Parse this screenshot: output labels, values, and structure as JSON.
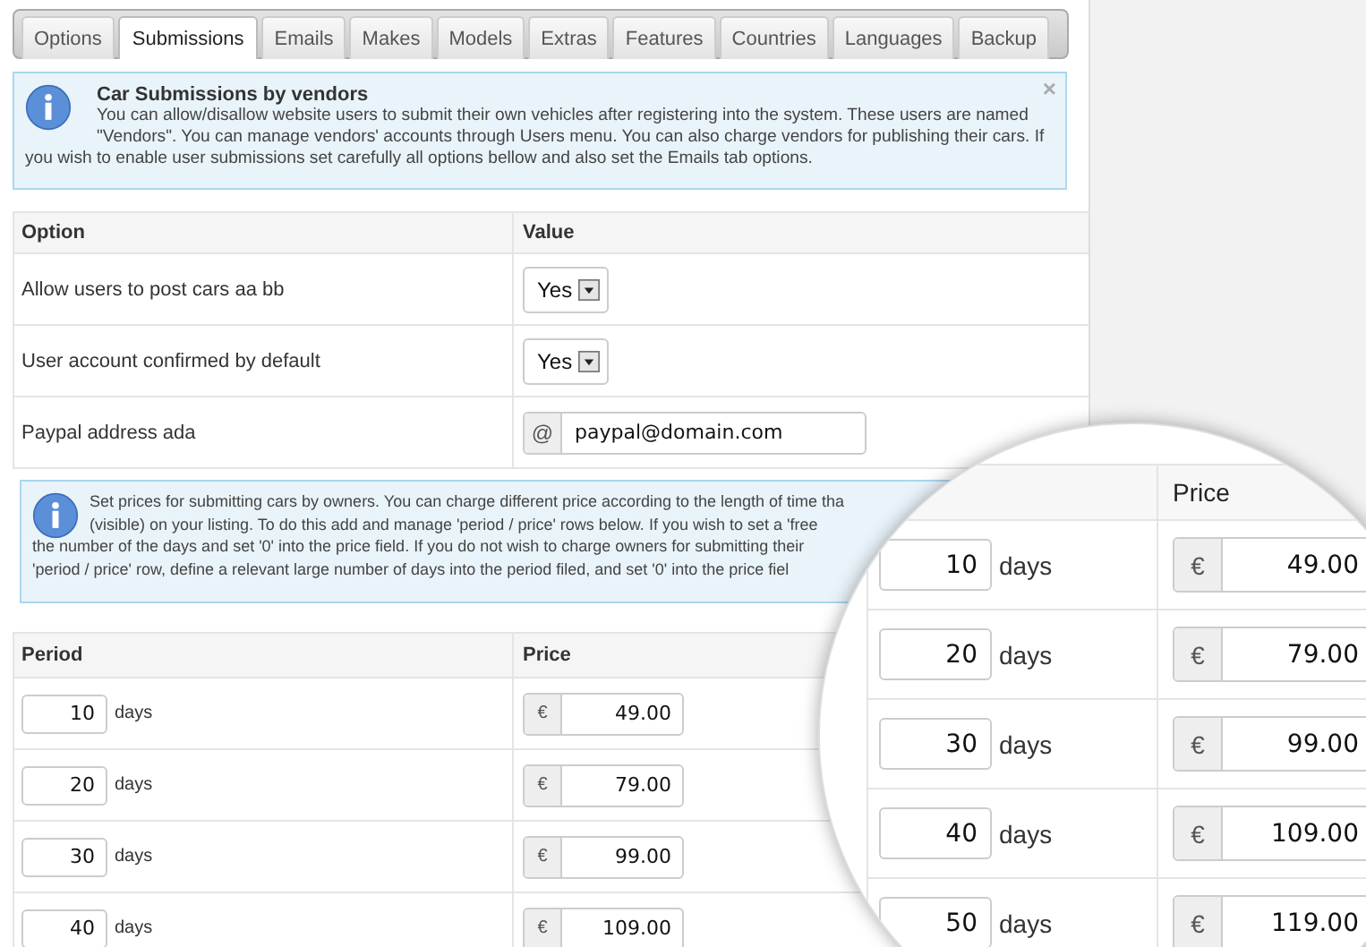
{
  "tabs": [
    {
      "label": "Options",
      "selected": false
    },
    {
      "label": "Submissions",
      "selected": true
    },
    {
      "label": "Emails",
      "selected": false
    },
    {
      "label": "Makes",
      "selected": false
    },
    {
      "label": "Models",
      "selected": false
    },
    {
      "label": "Extras",
      "selected": false
    },
    {
      "label": "Features",
      "selected": false
    },
    {
      "label": "Countries",
      "selected": false
    },
    {
      "label": "Languages",
      "selected": false
    },
    {
      "label": "Backup",
      "selected": false
    }
  ],
  "notice": {
    "title": "Car Submissions by vendors",
    "lines": [
      "You can allow/disallow website users to submit their own vehicles after registering into the system. These users are named",
      "\"Vendors\". You can manage vendors' accounts through Users menu. You can also charge vendors for publishing their cars. If",
      "you wish to enable user submissions set carefully all options bellow and also set the Emails tab options."
    ],
    "close": "×"
  },
  "options_table": {
    "columns": [
      "Option",
      "Value"
    ],
    "rows": [
      {
        "kind": "select",
        "label": "Allow users to post cars aa bb",
        "value": "Yes"
      },
      {
        "kind": "select",
        "label": "User account confirmed by default",
        "value": "Yes"
      },
      {
        "kind": "email",
        "label": "Paypal address ada",
        "prefix": "@",
        "value": "paypal@domain.com"
      }
    ]
  },
  "pricing_notice": {
    "lines": [
      "Set prices for submitting cars by owners. You can charge different price according to the length of time tha",
      "(visible) on your listing. To do this add and manage 'period / price' rows below. If you wish to set a 'free",
      "the number of the days and set '0' into the price field. If you do not wish to charge owners for submitting their",
      "'period / price' row, define a relevant large number of days into the period filed, and set '0' into the price fiel"
    ]
  },
  "pricing_table": {
    "columns": [
      "Period",
      "Price"
    ],
    "rows": [
      {
        "period": "10",
        "unit": "days",
        "currency": "€",
        "price": "49.00"
      },
      {
        "period": "20",
        "unit": "days",
        "currency": "€",
        "price": "79.00"
      },
      {
        "period": "30",
        "unit": "days",
        "currency": "€",
        "price": "99.00"
      },
      {
        "period": "40",
        "unit": "days",
        "currency": "€",
        "price": "109.00"
      }
    ]
  },
  "magnifier": {
    "price_header": "Price",
    "rows": [
      {
        "period": "10",
        "unit": "days",
        "currency": "€",
        "price": "49.00"
      },
      {
        "period": "20",
        "unit": "days",
        "currency": "€",
        "price": "79.00"
      },
      {
        "period": "30",
        "unit": "days",
        "currency": "€",
        "price": "99.00"
      },
      {
        "period": "40",
        "unit": "days",
        "currency": "€",
        "price": "109.00"
      },
      {
        "period": "50",
        "unit": "days",
        "currency": "€",
        "price": "119.00"
      }
    ]
  }
}
